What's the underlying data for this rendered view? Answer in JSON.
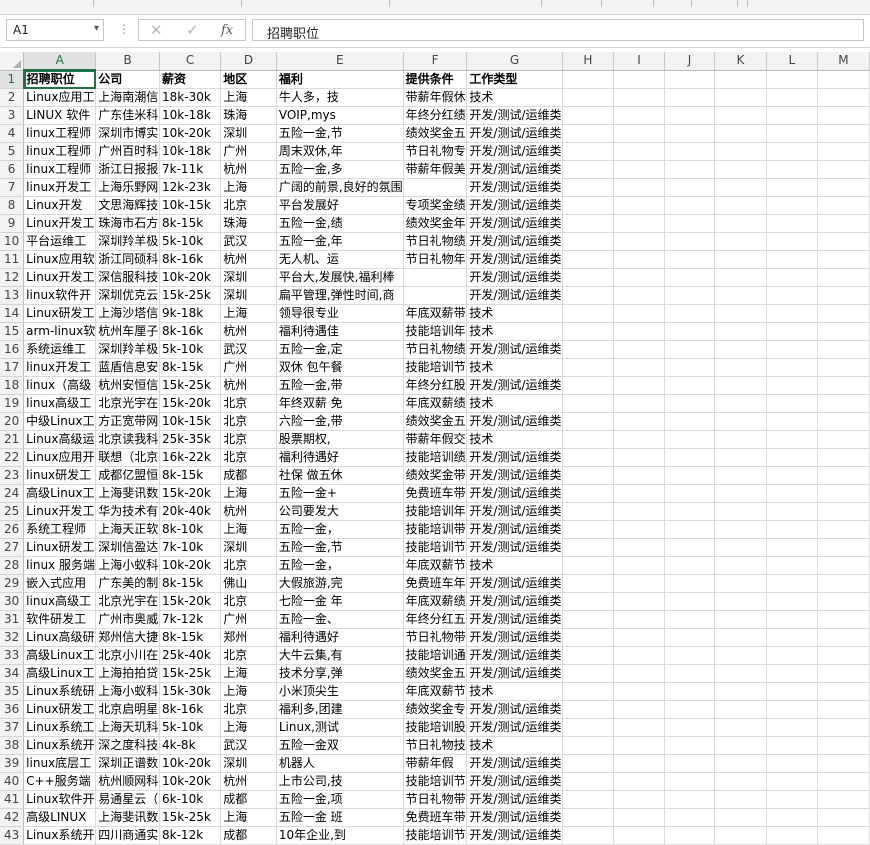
{
  "name_box": {
    "value": "A1",
    "dropdown_glyph": "▾"
  },
  "formula_bar": {
    "more_glyph": "⋮",
    "cancel_glyph": "✕",
    "enter_glyph": "✓",
    "fx_glyph": "fx",
    "content": "招聘职位"
  },
  "columns": [
    "A",
    "B",
    "C",
    "D",
    "E",
    "F",
    "G",
    "H",
    "I",
    "J",
    "K",
    "L",
    "M"
  ],
  "selected_column": "A",
  "selected_row": 1,
  "rows": [
    [
      "招聘职位",
      "公司",
      "薪资",
      "地区",
      "福利",
      "提供条件",
      "工作类型"
    ],
    [
      "Linux应用工",
      "上海南潮信",
      "18k-30k",
      "上海",
      "牛人多，技",
      "带薪年假休",
      "技术"
    ],
    [
      "LINUX 软件",
      "广东佳米科",
      "10k-18k",
      "珠海",
      "VOIP,mys",
      "年终分红绩",
      "开发/测试/运维类"
    ],
    [
      "linux工程师",
      "深圳市博实",
      "10k-20k",
      "深圳",
      "五险一金,节",
      "绩效奖金五",
      "开发/测试/运维类"
    ],
    [
      "linux工程师",
      "广州百时科",
      "10k-18k",
      "广州",
      "周末双休,年",
      "节日礼物专",
      "开发/测试/运维类"
    ],
    [
      "linux工程师",
      "浙江日报报",
      "7k-11k",
      "杭州",
      "五险一金,多",
      "带薪年假美",
      "开发/测试/运维类"
    ],
    [
      "linux开发工",
      "上海乐野网",
      "12k-23k",
      "上海",
      "广阔的前景,良好的氛围",
      "",
      "开发/测试/运维类"
    ],
    [
      "Linux开发",
      "文思海辉技",
      "10k-15k",
      "北京",
      "平台发展好",
      "专项奖金绩",
      "开发/测试/运维类"
    ],
    [
      "Linux开发工",
      "珠海市石方",
      "8k-15k",
      "珠海",
      "五险一金,绩",
      "绩效奖金年",
      "开发/测试/运维类"
    ],
    [
      "平台运维工",
      "深圳羚羊极",
      "5k-10k",
      "武汉",
      "五险一金,年",
      "节日礼物绩",
      "开发/测试/运维类"
    ],
    [
      "Linux应用软",
      "浙江同硕科",
      "8k-16k",
      "杭州",
      "无人机、运",
      "节日礼物年",
      "开发/测试/运维类"
    ],
    [
      "Linux开发工",
      "深信服科技",
      "10k-20k",
      "深圳",
      "平台大,发展快,福利棒",
      "",
      "开发/测试/运维类"
    ],
    [
      "linux软件开",
      "深圳优克云",
      "15k-25k",
      "深圳",
      "扁平管理,弹性时间,商",
      "",
      "开发/测试/运维类"
    ],
    [
      "Linux研发工",
      "上海沙塔信",
      "9k-18k",
      "上海",
      "领导很专业",
      "年底双薪带",
      "技术"
    ],
    [
      "arm-linux软",
      "杭州车厘子",
      "8k-16k",
      "杭州",
      "福利待遇佳",
      "技能培训年",
      "技术"
    ],
    [
      "系统运维工",
      "深圳羚羊极",
      "5k-10k",
      "武汉",
      "五险一金,定",
      "节日礼物绩",
      "开发/测试/运维类"
    ],
    [
      "linux开发工",
      "蓝盾信息安",
      "8k-15k",
      "广州",
      "双休 包午餐",
      "技能培训节",
      "技术"
    ],
    [
      "linux（高级",
      "杭州安恒信",
      "15k-25k",
      "杭州",
      "五险一金,带",
      "年终分红股",
      "开发/测试/运维类"
    ],
    [
      "linux高级工",
      "北京光宇在",
      "15k-20k",
      "北京",
      "年终双薪 免",
      "年底双薪绩",
      "技术"
    ],
    [
      "中级Linux工",
      "方正宽带网",
      "10k-15k",
      "北京",
      "六险一金,带",
      "绩效奖金五",
      "开发/测试/运维类"
    ],
    [
      "Linux高级运",
      "北京读我科",
      "25k-35k",
      "北京",
      "股票期权,",
      "带薪年假交",
      "技术"
    ],
    [
      "Linux应用开",
      "联想（北京",
      "16k-22k",
      "北京",
      "福利待遇好",
      "技能培训绩",
      "开发/测试/运维类"
    ],
    [
      "linux研发工",
      "成都亿盟恒",
      "8k-15k",
      "成都",
      "社保 做五休",
      "绩效奖金带",
      "开发/测试/运维类"
    ],
    [
      "高级Linux工",
      "上海斐讯数",
      "15k-20k",
      "上海",
      "五险一金+",
      "免费班车带",
      "开发/测试/运维类"
    ],
    [
      "Linux开发工",
      "华为技术有",
      "20k-40k",
      "杭州",
      "公司要发大",
      "技能培训年",
      "开发/测试/运维类"
    ],
    [
      "系统工程师",
      "上海天正软",
      "8k-10k",
      "上海",
      "五险一金，",
      "技能培训带",
      "开发/测试/运维类"
    ],
    [
      "Linux研发工",
      "深圳信盈达",
      "7k-10k",
      "深圳",
      "五险一金,节",
      "技能培训节",
      "开发/测试/运维类"
    ],
    [
      "linux 服务端",
      "上海小蚁科",
      "10k-20k",
      "北京",
      "五险一金，",
      "年底双薪节",
      "技术"
    ],
    [
      "嵌入式应用",
      "广东美的制",
      "8k-15k",
      "佛山",
      "大假旅游,完",
      "免费班车年",
      "开发/测试/运维类"
    ],
    [
      "linux高级工",
      "北京光宇在",
      "15k-20k",
      "北京",
      "七险一金 年",
      "年底双薪绩",
      "开发/测试/运维类"
    ],
    [
      "软件研发工",
      "广州市奥威",
      "7k-12k",
      "广州",
      "五险一金、",
      "年终分红五",
      "开发/测试/运维类"
    ],
    [
      "Linux高级研",
      "郑州信大捷",
      "8k-15k",
      "郑州",
      "福利待遇好",
      "节日礼物带",
      "开发/测试/运维类"
    ],
    [
      "高级Linux工",
      "北京小川在",
      "25k-40k",
      "北京",
      "大牛云集,有",
      "技能培训通",
      "开发/测试/运维类"
    ],
    [
      "高级Linux工",
      "上海拍拍贷",
      "15k-25k",
      "上海",
      "技术分享,弹",
      "绩效奖金五",
      "开发/测试/运维类"
    ],
    [
      "Linux系统研",
      "上海小蚁科",
      "15k-30k",
      "上海",
      "小米顶尖生",
      "年底双薪节",
      "技术"
    ],
    [
      "Linux研发工",
      "北京启明星",
      "8k-16k",
      "北京",
      "福利多,团建",
      "绩效奖金专",
      "开发/测试/运维类"
    ],
    [
      "Linux系统工",
      "上海天玑科",
      "5k-10k",
      "上海",
      "Linux,测试",
      "技能培训股",
      "开发/测试/运维类"
    ],
    [
      "Linux系统开",
      "深之度科技",
      "4k-8k",
      "武汉",
      "五险一金双",
      "节日礼物技",
      "技术"
    ],
    [
      "linux底层工",
      "深圳正谱数",
      "10k-20k",
      "深圳",
      "机器人",
      "带薪年假",
      "开发/测试/运维类"
    ],
    [
      "C++服务端",
      "杭州顺网科",
      "10k-20k",
      "杭州",
      "上市公司,技",
      "技能培训节",
      "开发/测试/运维类"
    ],
    [
      "Linux软件开",
      "易通星云（",
      "6k-10k",
      "成都",
      "五险一金,项",
      "节日礼物带",
      "开发/测试/运维类"
    ],
    [
      "高级LINUX",
      "上海斐讯数",
      "15k-25k",
      "上海",
      "五险一金 班",
      "免费班车带",
      "开发/测试/运维类"
    ],
    [
      "Linux系统开",
      "四川商通实",
      "8k-12k",
      "成都",
      "10年企业,到",
      "技能培训节",
      "开发/测试/运维类"
    ]
  ]
}
